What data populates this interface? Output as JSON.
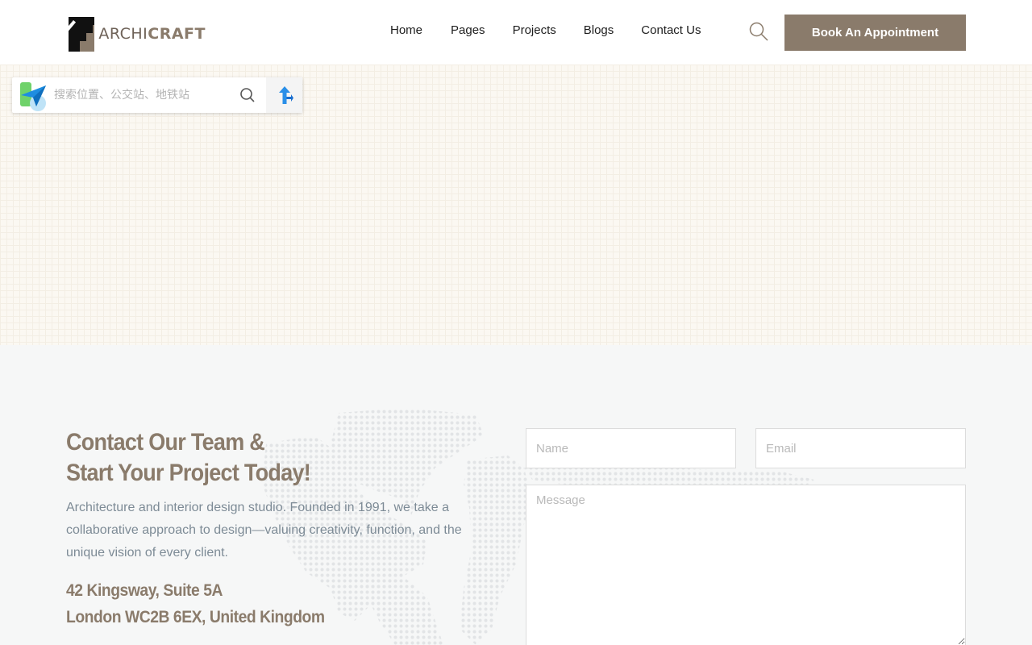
{
  "header": {
    "logo_prefix": "ARCHI",
    "logo_suffix": "CRAFT",
    "nav": [
      "Home",
      "Pages",
      "Projects",
      "Blogs",
      "Contact Us"
    ],
    "book_label": "Book An Appointment"
  },
  "map": {
    "search_placeholder": "搜索位置、公交站、地铁站"
  },
  "contact": {
    "title_line1": "Contact Our Team &",
    "title_line2": "Start Your Project Today!",
    "description": "Architecture and interior design studio. Founded in 1991, we take a collaborative approach to design—valuing creativity, function, and the unique vision of every client.",
    "address_line1": "42 Kingsway, Suite 5A",
    "address_line2": "London WC2B 6EX, United Kingdom",
    "form": {
      "name_placeholder": "Name",
      "email_placeholder": "Email",
      "message_placeholder": "Message"
    }
  },
  "colors": {
    "brand": "#8a7b6b",
    "text_muted": "#7d8b96"
  }
}
